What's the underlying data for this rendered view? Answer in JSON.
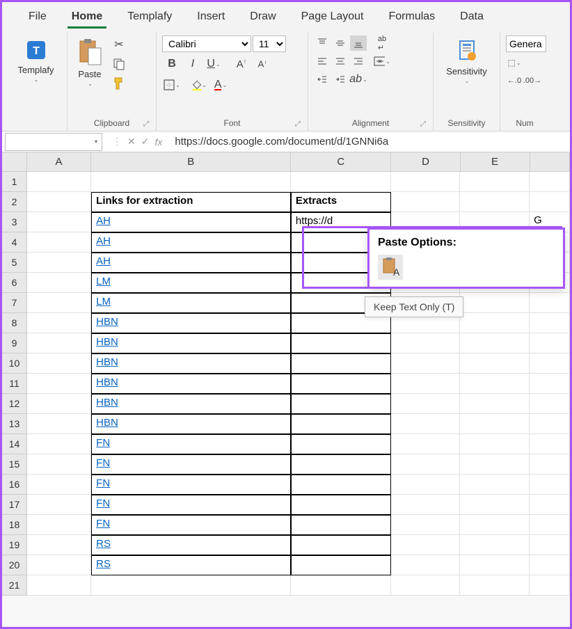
{
  "tabs": [
    "File",
    "Home",
    "Templafy",
    "Insert",
    "Draw",
    "Page Layout",
    "Formulas",
    "Data"
  ],
  "active_tab": 1,
  "ribbon": {
    "templafy": {
      "label": "Templafy"
    },
    "clipboard": {
      "label": "Clipboard",
      "paste": "Paste"
    },
    "font": {
      "label": "Font",
      "family": "Calibri",
      "size": "11"
    },
    "alignment": {
      "label": "Alignment"
    },
    "sensitivity": {
      "label": "Sensitivity",
      "btn": "Sensitivity"
    },
    "number": {
      "label": "Num",
      "format": "Genera"
    }
  },
  "formula_bar": {
    "namebox": "",
    "formula": "https://docs.google.com/document/d/1GNNi6a"
  },
  "columns": [
    "A",
    "B",
    "C",
    "D",
    "E"
  ],
  "rows_count": 21,
  "headers": {
    "b": "Links for extraction",
    "c": "Extracts"
  },
  "links": [
    "AH",
    "AH",
    "AH",
    "LM",
    "LM",
    "HBN",
    "HBN",
    "HBN",
    "HBN",
    "HBN",
    "HBN",
    "FN",
    "FN",
    "FN",
    "FN",
    "FN",
    "RS",
    "RS"
  ],
  "c3": "https://d",
  "c3_overflow": "G",
  "paste_popup": {
    "title": "Paste Options:",
    "tooltip": "Keep Text Only (T)"
  }
}
